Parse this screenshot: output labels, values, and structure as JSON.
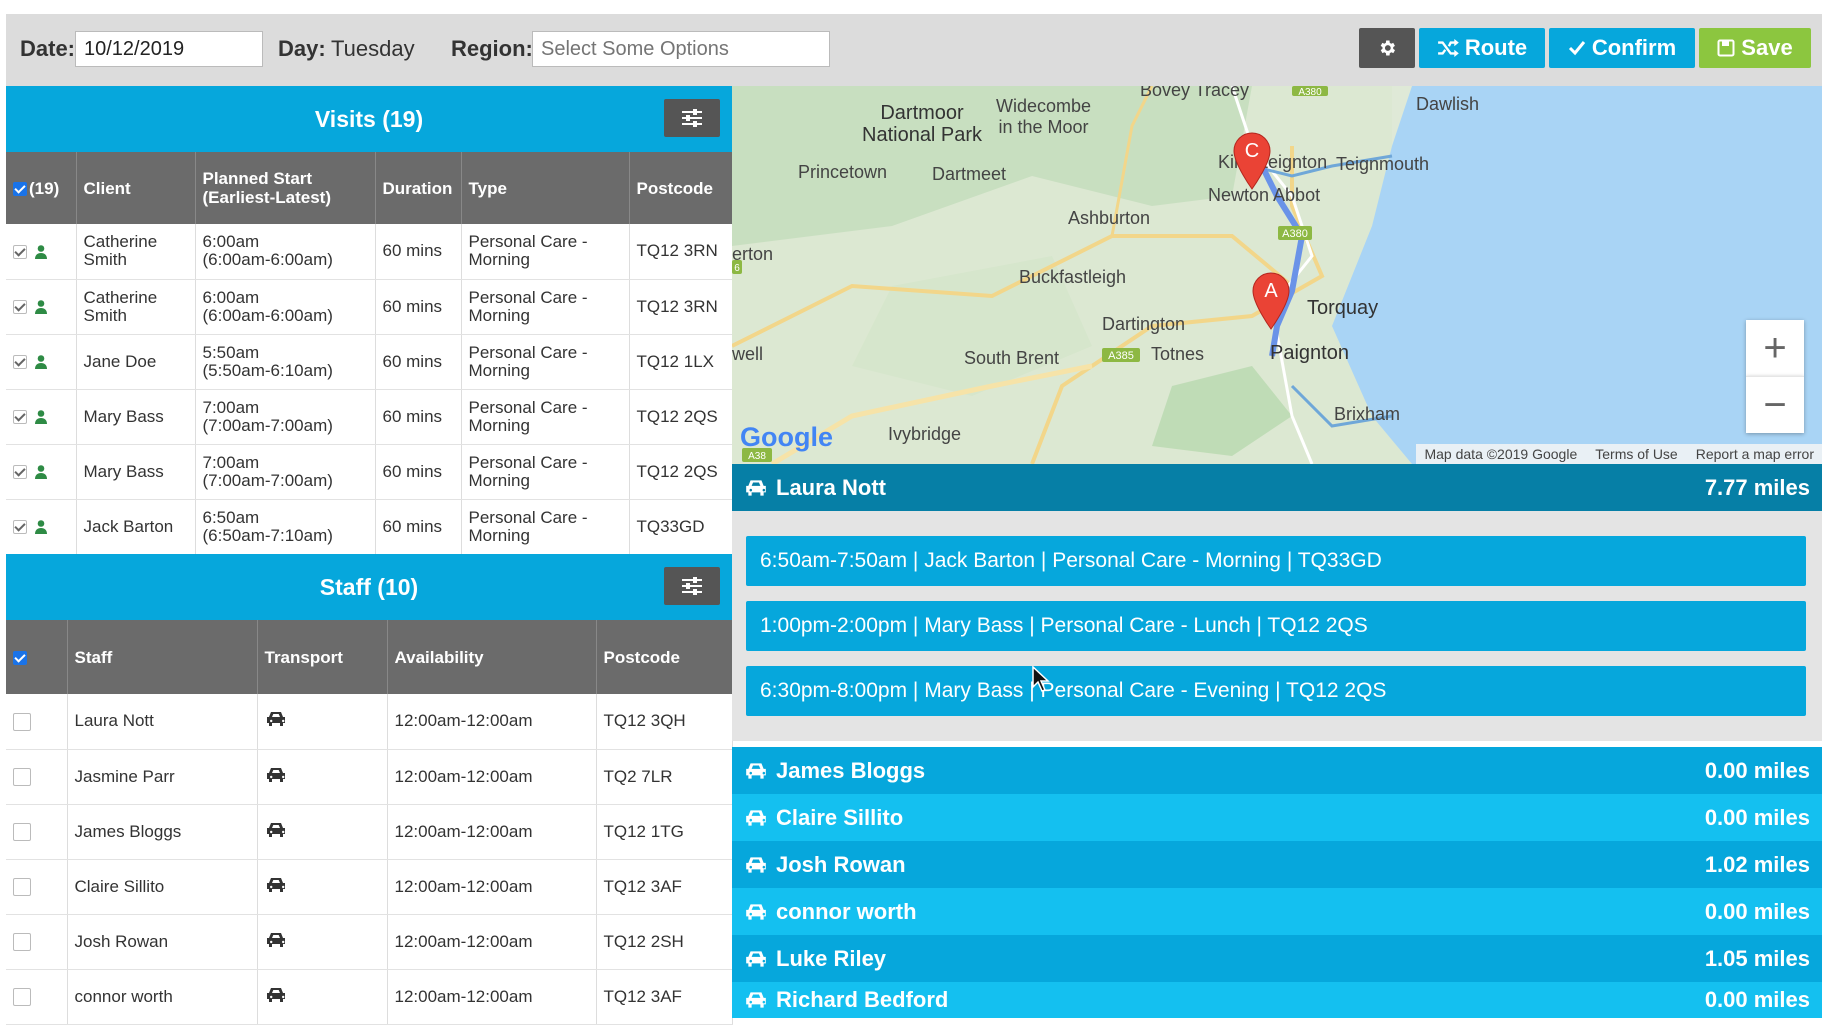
{
  "toolbar": {
    "date_label": "Date:",
    "date_value": "10/12/2019",
    "day_label": "Day:",
    "day_value": "Tuesday",
    "region_label": "Region:",
    "region_placeholder": "Select Some Options",
    "route_label": "Route",
    "confirm_label": "Confirm",
    "save_label": "Save",
    "colors": {
      "settings": "#555555",
      "route": "#06a7dc",
      "confirm": "#06a7dc",
      "save": "#8cc63f"
    }
  },
  "visits": {
    "title": "Visits (19)",
    "select_count": "(19)",
    "columns": [
      "Client",
      "Planned Start (Earliest-Latest)",
      "Duration",
      "Type",
      "Postcode"
    ],
    "rows": [
      {
        "client": "Catherine Smith",
        "start": "6:00am",
        "window": "(6:00am-6:00am)",
        "duration": "60 mins",
        "type": "Personal Care - Morning",
        "postcode": "TQ12 3RN"
      },
      {
        "client": "Catherine Smith",
        "start": "6:00am",
        "window": "(6:00am-6:00am)",
        "duration": "60 mins",
        "type": "Personal Care - Morning",
        "postcode": "TQ12 3RN"
      },
      {
        "client": "Jane Doe",
        "start": "5:50am",
        "window": "(5:50am-6:10am)",
        "duration": "60 mins",
        "type": "Personal Care - Morning",
        "postcode": "TQ12 1LX"
      },
      {
        "client": "Mary Bass",
        "start": "7:00am",
        "window": "(7:00am-7:00am)",
        "duration": "60 mins",
        "type": "Personal Care - Morning",
        "postcode": "TQ12 2QS"
      },
      {
        "client": "Mary Bass",
        "start": "7:00am",
        "window": "(7:00am-7:00am)",
        "duration": "60 mins",
        "type": "Personal Care - Morning",
        "postcode": "TQ12 2QS"
      },
      {
        "client": "Jack Barton",
        "start": "6:50am",
        "window": "(6:50am-7:10am)",
        "duration": "60 mins",
        "type": "Personal Care - Morning",
        "postcode": "TQ33GD"
      }
    ]
  },
  "staff": {
    "title": "Staff (10)",
    "columns": [
      "Staff",
      "Transport",
      "Availability",
      "Postcode"
    ],
    "rows": [
      {
        "name": "Laura Nott",
        "transport": "car-icon",
        "availability": "12:00am-12:00am",
        "postcode": "TQ12 3QH"
      },
      {
        "name": "Jasmine Parr",
        "transport": "car-icon",
        "availability": "12:00am-12:00am",
        "postcode": "TQ2 7LR"
      },
      {
        "name": "James Bloggs",
        "transport": "car-icon",
        "availability": "12:00am-12:00am",
        "postcode": "TQ12 1TG"
      },
      {
        "name": "Claire Sillito",
        "transport": "car-icon",
        "availability": "12:00am-12:00am",
        "postcode": "TQ12 3AF"
      },
      {
        "name": "Josh Rowan",
        "transport": "car-icon",
        "availability": "12:00am-12:00am",
        "postcode": "TQ12 2SH"
      },
      {
        "name": "connor worth",
        "transport": "car-icon",
        "availability": "12:00am-12:00am",
        "postcode": "TQ12 3AF"
      }
    ]
  },
  "map": {
    "labels": {
      "bovey": "Bovey Tracey",
      "dartmoor": "Dartmoor\nNational Park",
      "widecombe": "Widecombe\nin the Moor",
      "dawlish": "Dawlish",
      "princetown": "Princetown",
      "dartmeet": "Dartmeet",
      "kingsteignton": "Kingsteignton",
      "teignmouth": "Teignmouth",
      "newton_abbot": "Newton Abbot",
      "ashburton": "Ashburton",
      "erton": "erton",
      "buckfastleigh": "Buckfastleigh",
      "torquay": "Torquay",
      "dartington": "Dartington",
      "well": "well",
      "south_brent": "South Brent",
      "totnes": "Totnes",
      "paignton": "Paignton",
      "brixham": "Brixham",
      "ivybridge": "Ivybridge"
    },
    "road_labels": {
      "a380_top": "A380",
      "a380": "A380",
      "a385": "A385",
      "a6": "6",
      "a38": "A38"
    },
    "marker_a": "A",
    "marker_c": "C",
    "logo": "Google",
    "attribution": {
      "data": "Map data ©2019 Google",
      "terms": "Terms of Use",
      "report": "Report a map error"
    },
    "zoom_in": "+",
    "zoom_out": "−"
  },
  "routes": {
    "active": {
      "name": "Laura Nott",
      "miles": "7.77 miles",
      "visits": [
        "6:50am-7:50am | Jack Barton | Personal Care - Morning | TQ33GD",
        "1:00pm-2:00pm | Mary Bass | Personal Care - Lunch | TQ12 2QS",
        "6:30pm-8:00pm | Mary Bass | Personal Care - Evening | TQ12 2QS"
      ]
    },
    "others": [
      {
        "name": "James Bloggs",
        "miles": "0.00 miles"
      },
      {
        "name": "Claire Sillito",
        "miles": "0.00 miles"
      },
      {
        "name": "Josh Rowan",
        "miles": "1.02 miles"
      },
      {
        "name": "connor worth",
        "miles": "0.00 miles"
      },
      {
        "name": "Luke Riley",
        "miles": "1.05 miles"
      },
      {
        "name": "Richard Bedford",
        "miles": "0.00 miles"
      }
    ]
  }
}
